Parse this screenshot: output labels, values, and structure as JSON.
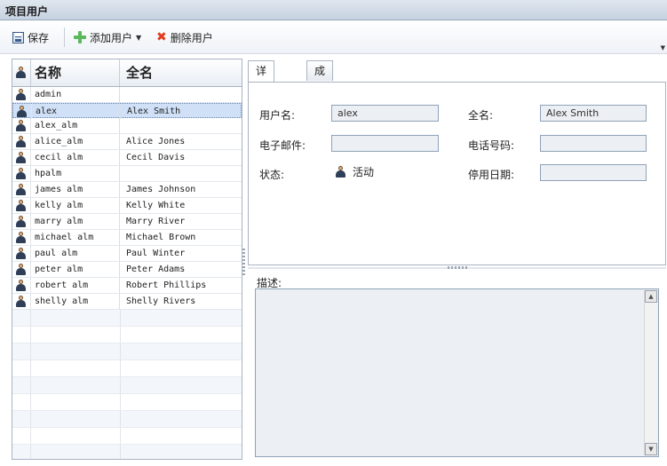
{
  "window": {
    "title": "项目用户"
  },
  "toolbar": {
    "save_label": "保存",
    "add_user_label": "添加用户",
    "delete_user_label": "删除用户"
  },
  "grid": {
    "columns": [
      "名称",
      "全名"
    ],
    "rows": [
      {
        "name": "admin",
        "full_name": ""
      },
      {
        "name": "alex",
        "full_name": "Alex Smith"
      },
      {
        "name": "alex_alm",
        "full_name": ""
      },
      {
        "name": "alice_alm",
        "full_name": "Alice Jones"
      },
      {
        "name": "cecil alm",
        "full_name": "Cecil Davis"
      },
      {
        "name": "hpalm",
        "full_name": ""
      },
      {
        "name": "james alm",
        "full_name": "James Johnson"
      },
      {
        "name": "kelly alm",
        "full_name": "Kelly White"
      },
      {
        "name": "marry alm",
        "full_name": "Marry River"
      },
      {
        "name": "michael alm",
        "full_name": "Michael Brown"
      },
      {
        "name": "paul alm",
        "full_name": "Paul Winter"
      },
      {
        "name": "peter alm",
        "full_name": "Peter Adams"
      },
      {
        "name": "robert alm",
        "full_name": "Robert Phillips"
      },
      {
        "name": "shelly alm",
        "full_name": "Shelly Rivers"
      }
    ],
    "selected_index": 1
  },
  "tabs": [
    "详细信息",
    "成员资格"
  ],
  "details": {
    "username_label": "用户名:",
    "username_value": "alex",
    "fullname_label": "全名:",
    "fullname_value": "Alex Smith",
    "email_label": "电子邮件:",
    "email_value": "",
    "phone_label": "电话号码:",
    "phone_value": "",
    "status_label": "状态:",
    "status_value": "活动",
    "deactivation_label": "停用日期:",
    "deactivation_value": ""
  },
  "description": {
    "label": "描述:"
  }
}
